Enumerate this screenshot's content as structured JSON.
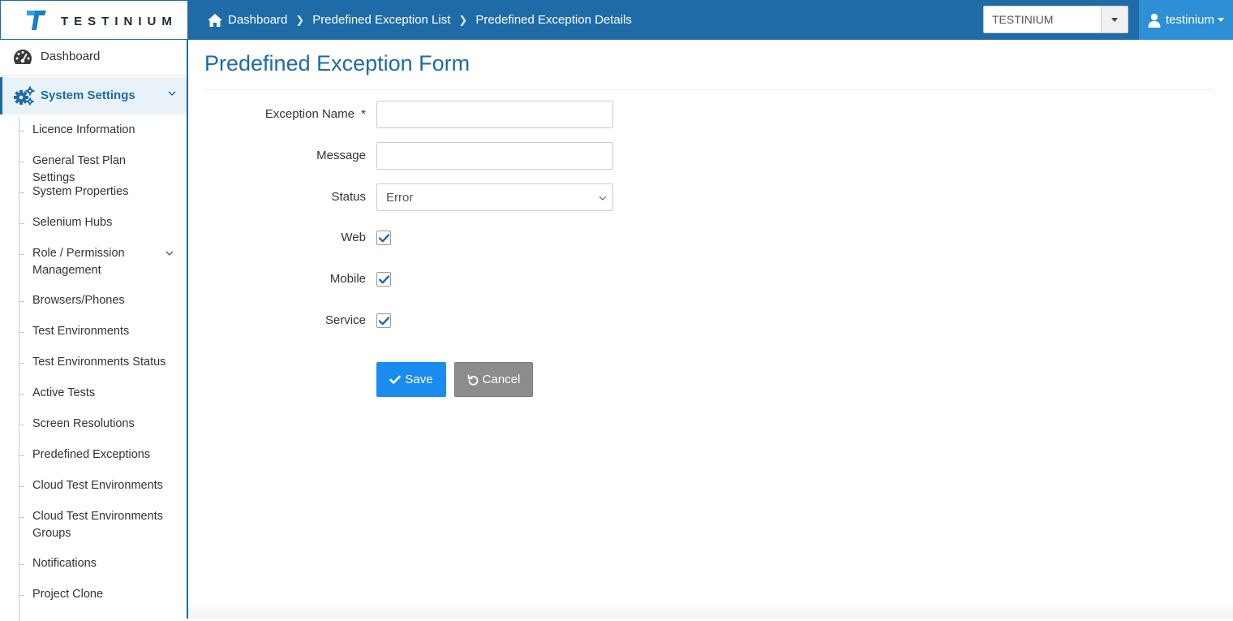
{
  "app": {
    "logo_text": "TESTINIUM"
  },
  "breadcrumb": {
    "items": [
      "Dashboard",
      "Predefined Exception List",
      "Predefined Exception Details"
    ]
  },
  "company_select": {
    "value": "TESTINIUM"
  },
  "user_menu": {
    "username": "testinium"
  },
  "sidebar": {
    "dashboard": "Dashboard",
    "system_settings": "System Settings",
    "items": [
      "Licence Information",
      "General Test Plan Settings",
      "System Properties",
      "Selenium Hubs",
      "Role / Permission Management",
      "Browsers/Phones",
      "Test Environments",
      "Test Environments Status",
      "Active Tests",
      "Screen Resolutions",
      "Predefined Exceptions",
      "Cloud Test Environments",
      "Cloud Test Environments Groups",
      "Notifications",
      "Project Clone"
    ]
  },
  "form": {
    "title": "Predefined Exception Form",
    "exception_name_label": "Exception Name",
    "required_mark": "*",
    "exception_name_value": "",
    "message_label": "Message",
    "message_value": "",
    "status_label": "Status",
    "status_value": "Error",
    "web_label": "Web",
    "web_checked": true,
    "mobile_label": "Mobile",
    "mobile_checked": true,
    "service_label": "Service",
    "service_checked": true,
    "save_label": "Save",
    "cancel_label": "Cancel"
  },
  "colors": {
    "topbar": "#1e6ba8",
    "user_menu": "#2d8fd5",
    "save_button": "#1a8cf0",
    "cancel_button": "#8c8c8c",
    "title": "#1e6ba8"
  }
}
